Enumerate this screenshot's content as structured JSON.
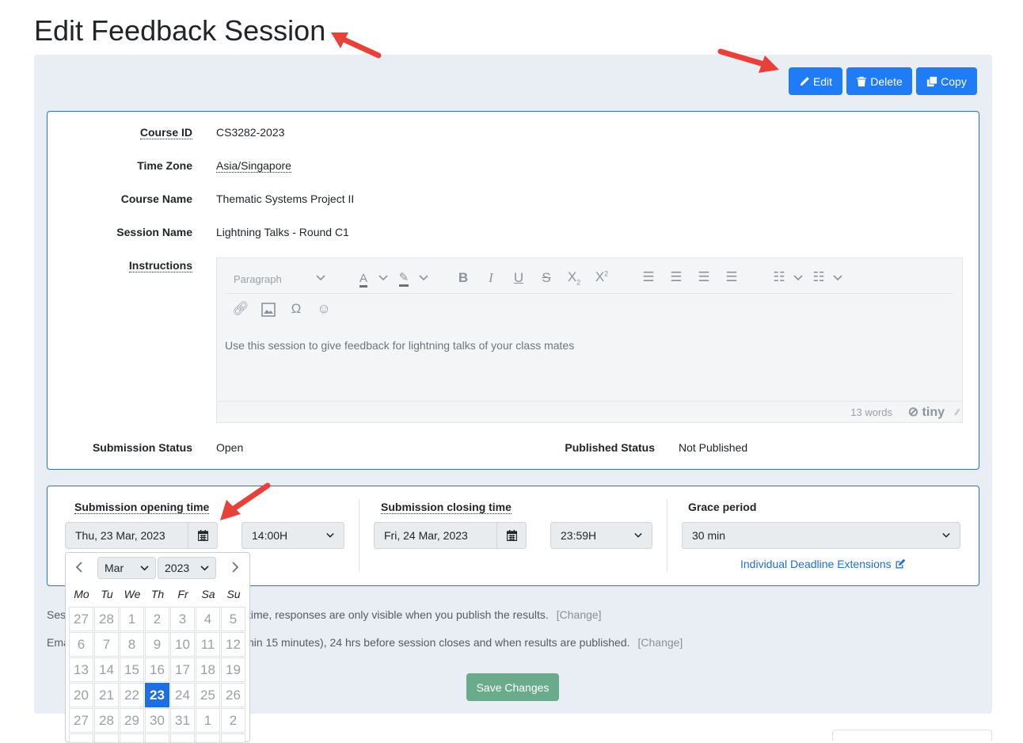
{
  "page": {
    "title": "Edit Feedback Session"
  },
  "actions": {
    "edit": "Edit",
    "delete": "Delete",
    "copy": "Copy"
  },
  "details": {
    "course_id_label": "Course ID",
    "course_id": "CS3282-2023",
    "time_zone_label": "Time Zone",
    "time_zone": "Asia/Singapore",
    "course_name_label": "Course Name",
    "course_name": "Thematic Systems Project II",
    "session_name_label": "Session Name",
    "session_name": "Lightning Talks - Round C1",
    "instructions_label": "Instructions",
    "submission_status_label": "Submission Status",
    "submission_status": "Open",
    "published_status_label": "Published Status",
    "published_status": "Not Published"
  },
  "editor": {
    "block_format": "Paragraph",
    "content": "Use this session to give feedback for lightning talks of your class mates",
    "word_count": "13 words",
    "brand": "tiny"
  },
  "timing": {
    "opening_label": "Submission opening time",
    "opening_date": "Thu, 23 Mar, 2023",
    "opening_time": "14:00H",
    "closing_label": "Submission closing time",
    "closing_date": "Fri, 24 Mar, 2023",
    "closing_time": "23:59H",
    "grace_label": "Grace period",
    "grace_value": "30 min",
    "extensions_link": "Individual Deadline Extensions"
  },
  "notes": {
    "visibility_prefix": "Ses",
    "visibility_text": "time, responses are only visible when you publish the results.",
    "email_prefix": "Ema",
    "email_text": "hin 15 minutes), 24 hrs before session closes and when results are published.",
    "change": "[Change]"
  },
  "save_label": "Save Changes",
  "calendar": {
    "month": "Mar",
    "year": "2023",
    "weekdays": [
      "Mo",
      "Tu",
      "We",
      "Th",
      "Fr",
      "Sa",
      "Su"
    ],
    "weeks": [
      [
        "27",
        "28",
        "1",
        "2",
        "3",
        "4",
        "5"
      ],
      [
        "6",
        "7",
        "8",
        "9",
        "10",
        "11",
        "12"
      ],
      [
        "13",
        "14",
        "15",
        "16",
        "17",
        "18",
        "19"
      ],
      [
        "20",
        "21",
        "22",
        "23",
        "24",
        "25",
        "26"
      ],
      [
        "27",
        "28",
        "29",
        "30",
        "31",
        "1",
        "2"
      ]
    ],
    "selected_day": "23"
  },
  "colors": {
    "accent": "#1f7cf5",
    "save": "#6aab8b",
    "annotation_arrow": "#e8413a"
  }
}
